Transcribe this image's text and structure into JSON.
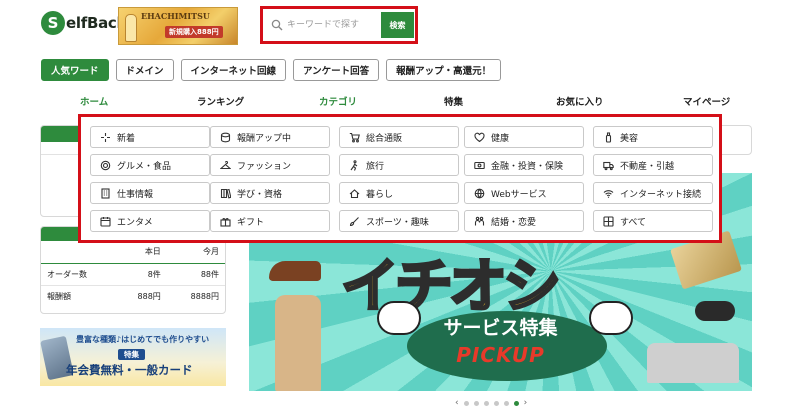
{
  "logo": {
    "mark": "S",
    "text": "elfBack"
  },
  "ad_banner": {
    "brand": "EHACHIMITSU",
    "badge": "新規購入888円"
  },
  "search": {
    "placeholder": "キーワードで探す",
    "button_label": "検索"
  },
  "chips": [
    {
      "label": "人気ワード",
      "active": true
    },
    {
      "label": "ドメイン",
      "active": false
    },
    {
      "label": "インターネット回線",
      "active": false
    },
    {
      "label": "アンケート回答",
      "active": false
    },
    {
      "label": "報酬アップ・高還元！",
      "active": false
    }
  ],
  "nav": [
    {
      "label": "ホーム",
      "highlight": true
    },
    {
      "label": "ランキング",
      "highlight": false
    },
    {
      "label": "カテゴリ",
      "highlight": true
    },
    {
      "label": "特集",
      "highlight": false
    },
    {
      "label": "お気に入り",
      "highlight": false
    },
    {
      "label": "マイページ",
      "highlight": false
    }
  ],
  "categories": [
    [
      {
        "label": "新着",
        "icon": "sparkle-icon"
      },
      {
        "label": "報酬アップ中",
        "icon": "coins-icon"
      },
      {
        "label": "総合通販",
        "icon": "cart-icon"
      },
      {
        "label": "健康",
        "icon": "heart-pulse-icon"
      },
      {
        "label": "美容",
        "icon": "bottle-icon"
      }
    ],
    [
      {
        "label": "グルメ・食品",
        "icon": "utensils-icon"
      },
      {
        "label": "ファッション",
        "icon": "hanger-icon"
      },
      {
        "label": "旅行",
        "icon": "walker-icon"
      },
      {
        "label": "金融・投資・保険",
        "icon": "money-icon"
      },
      {
        "label": "不動産・引越",
        "icon": "truck-icon"
      }
    ],
    [
      {
        "label": "仕事情報",
        "icon": "building-icon"
      },
      {
        "label": "学び・資格",
        "icon": "books-icon"
      },
      {
        "label": "暮らし",
        "icon": "home-icon"
      },
      {
        "label": "Webサービス",
        "icon": "globe-icon"
      },
      {
        "label": "インターネット接続",
        "icon": "wifi-icon"
      }
    ],
    [
      {
        "label": "エンタメ",
        "icon": "calendar-icon"
      },
      {
        "label": "ギフト",
        "icon": "gift-icon"
      },
      {
        "label": "スポーツ・趣味",
        "icon": "brush-icon"
      },
      {
        "label": "結婚・恋愛",
        "icon": "couple-icon"
      },
      {
        "label": "すべて",
        "icon": "grid-icon"
      }
    ]
  ],
  "stats": {
    "headers": [
      "本日",
      "今月"
    ],
    "rows": [
      {
        "label": "オーダー数",
        "today": "8件",
        "month": "88件"
      },
      {
        "label": "報酬額",
        "today": "888円",
        "month": "8888円"
      }
    ]
  },
  "side_ad": {
    "line1": "豊富な種類♪はじめてでも作りやすい",
    "tag": "特集",
    "line3": "年会費無料・一般カード"
  },
  "hero": {
    "big_text": "イチオシ",
    "subtitle": "サービス特集",
    "pick": "PICKUP"
  },
  "carousel": {
    "count": 6,
    "active": 5
  },
  "colors": {
    "brand_green": "#2e8b3d",
    "highlight_red": "#d40f18"
  }
}
